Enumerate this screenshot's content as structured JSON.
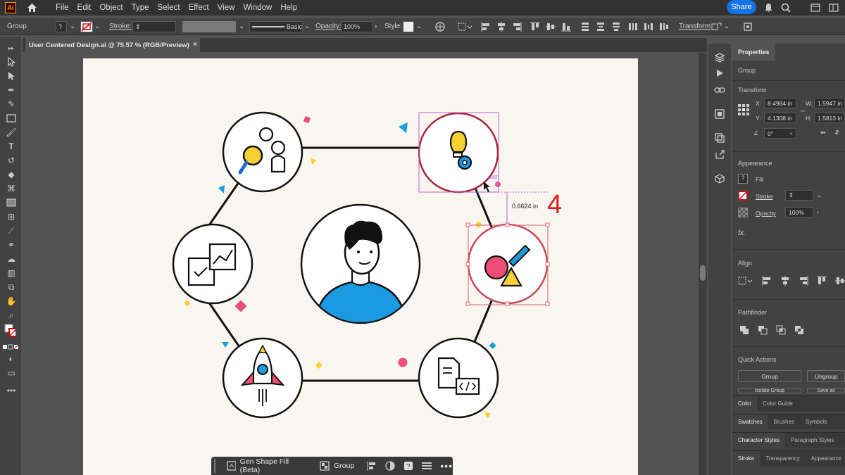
{
  "app": {
    "logo": "Ai",
    "menu": [
      "File",
      "Edit",
      "Object",
      "Type",
      "Select",
      "Effect",
      "View",
      "Window",
      "Help"
    ],
    "share_label": "Share"
  },
  "control_bar": {
    "selection": "Group",
    "stroke_label": "Stroke:",
    "brush_label": "Basic",
    "opacity_label": "Opacity:",
    "opacity_value": "100%",
    "style_label": "Style:",
    "transform_label": "Transform"
  },
  "document": {
    "tab_title": "User Centered Design.ai @ 75.57 % (RGB/Preview)",
    "close": "×"
  },
  "canvas": {
    "smart_guide_label": "path",
    "measure_label": "0.6624 in",
    "annotation_number": "4"
  },
  "properties": {
    "tab": "Properties",
    "selection_type": "Group",
    "transform": {
      "title": "Transform",
      "x_label": "X:",
      "x": "8.4984 in",
      "y_label": "Y:",
      "y": "4.1308 in",
      "w_label": "W:",
      "w": "1.5947 in",
      "h_label": "H:",
      "h": "1.5813 in",
      "angle": "0°"
    },
    "appearance": {
      "title": "Appearance",
      "fill": "Fill",
      "stroke": "Stroke",
      "opacity": "Opacity",
      "opacity_value": "100%",
      "fx": "fx."
    },
    "align_title": "Align",
    "pathfinder_title": "Pathfinder",
    "quick_actions": {
      "title": "Quick Actions",
      "group": "Group",
      "ungroup": "Ungroup",
      "isolate": "Isolate Group",
      "save": "Save as"
    },
    "bottom_tabs": [
      [
        "Color",
        "Color Guide"
      ],
      [
        "Swatches",
        "Brushes",
        "Symbols"
      ],
      [
        "Character Styles",
        "Paragraph Styles"
      ],
      [
        "Stroke",
        "Transparency",
        "Appearance"
      ]
    ]
  },
  "context_bar": {
    "gen_fill": "Gen Shape Fill (Beta)",
    "group": "Group"
  },
  "colors": {
    "accent": "#1473e6",
    "selection": "#c15bd6",
    "annotation": "#e0201b",
    "pink": "#ee4d78",
    "yellow": "#f7d033",
    "blue": "#1a9ae0"
  }
}
